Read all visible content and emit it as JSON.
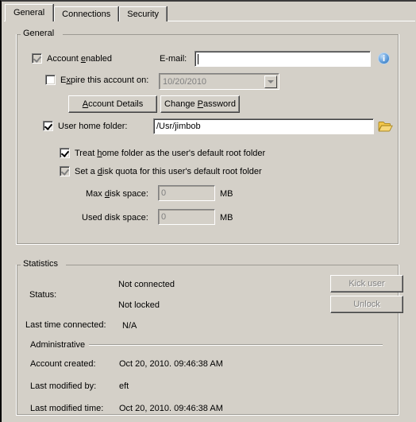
{
  "tabs": [
    {
      "label": "General",
      "selected": true
    },
    {
      "label": "Connections",
      "selected": false
    },
    {
      "label": "Security",
      "selected": false
    }
  ],
  "general_group": {
    "title": "General",
    "account_enabled": {
      "label": "Account enabled",
      "accel": "e",
      "checked": true,
      "enabled": false
    },
    "email": {
      "label": "E-mail:",
      "value": "",
      "placeholder": ""
    },
    "expire_account": {
      "label": "Expire this account on:",
      "accel": "x",
      "checked": false,
      "enabled": true
    },
    "expire_date": {
      "value": "10/20/2010",
      "enabled": false
    },
    "account_details_button": {
      "label": "Account Details",
      "accel": "A"
    },
    "change_password_button": {
      "label": "Change Password",
      "accel": "P"
    },
    "user_home_folder": {
      "label": "User home folder:",
      "checked": true,
      "enabled": true
    },
    "home_folder_path": {
      "value": "/Usr/jimbob"
    },
    "browse_folder_icon": "folder-open-icon",
    "info_icon": "info-icon",
    "treat_home_folder": {
      "label": "Treat home folder as the user's default root folder",
      "accel": "h",
      "checked": true,
      "enabled": true
    },
    "set_disk_quota": {
      "label": "Set a disk quota for this user's default root folder",
      "accel": "d",
      "checked": true,
      "enabled": false
    },
    "max_disk_space": {
      "label": "Max disk space:",
      "accel": "d",
      "value": "0",
      "unit": "MB",
      "enabled": false
    },
    "used_disk_space": {
      "label": "Used disk space:",
      "value": "0",
      "unit": "MB",
      "enabled": false
    }
  },
  "statistics_group": {
    "title": "Statistics",
    "status_label": "Status:",
    "status_connection": "Not connected",
    "status_lock": "Not locked",
    "last_time_connected_label": "Last time connected:",
    "last_time_connected_value": "N/A",
    "kick_user_button": {
      "label": "Kick user",
      "enabled": false
    },
    "unlock_button": {
      "label": "Unlock",
      "enabled": false
    },
    "administrative_label": "Administrative",
    "account_created_label": "Account created:",
    "account_created_value": "Oct 20, 2010. 09:46:38 AM",
    "last_modified_by_label": "Last modified by:",
    "last_modified_by_value": "eft",
    "last_modified_time_label": "Last modified time:",
    "last_modified_time_value": "Oct 20, 2010. 09:46:38 AM"
  },
  "colors": {
    "window_background": "#d4d0c8",
    "field_background": "#ffffff",
    "disabled_text": "#808080",
    "info_icon_blue": "#4a8fd6",
    "folder_icon_gold": "#e8b73a"
  }
}
